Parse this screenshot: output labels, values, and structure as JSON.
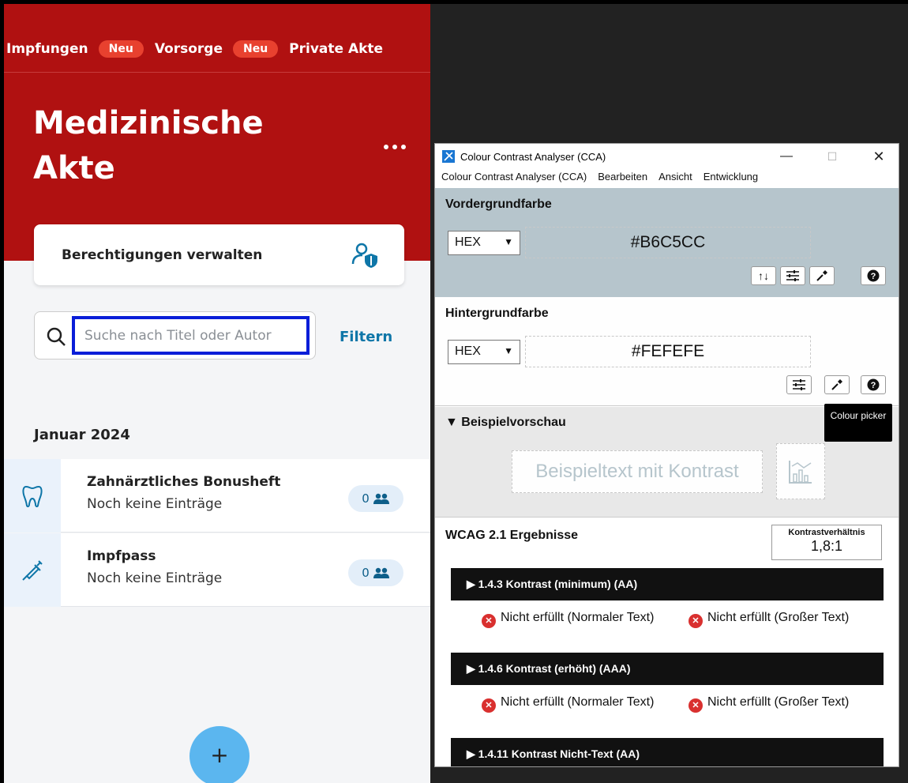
{
  "app": {
    "tabs": [
      {
        "label": "Impfungen",
        "badge": "Neu"
      },
      {
        "label": "Vorsorge",
        "badge": "Neu"
      },
      {
        "label": "Private Akte"
      }
    ],
    "page_title": "Medizinische Akte",
    "more_icon": "ellipsis-icon",
    "permissions": {
      "label": "Berechtigungen verwalten",
      "icon": "user-shield-icon"
    },
    "search": {
      "placeholder": "Suche nach Titel oder Autor",
      "value": ""
    },
    "filter_label": "Filtern",
    "month_heading": "Januar 2024",
    "records": [
      {
        "title": "Zahnärztliches Bonusheft",
        "subtitle": "Noch keine Einträge",
        "count": "0",
        "icon": "tooth-icon"
      },
      {
        "title": "Impfpass",
        "subtitle": "Noch keine Einträge",
        "count": "0",
        "icon": "syringe-icon"
      }
    ],
    "fab_label": "+",
    "colors": {
      "header": "#b01111",
      "badge": "#e8412f",
      "accent": "#0e76a8",
      "fab": "#5bb6ef",
      "focus": "#0a1ed8"
    }
  },
  "cca": {
    "window_title": "Colour Contrast Analyser (CCA)",
    "window_controls": {
      "minimize": "—",
      "maximize": "☐",
      "close": "✕"
    },
    "menu": [
      "Colour Contrast Analyser (CCA)",
      "Bearbeiten",
      "Ansicht",
      "Entwicklung"
    ],
    "foreground": {
      "heading": "Vordergrundfarbe",
      "format": "HEX",
      "value": "#B6C5CC",
      "color": "#b6c5cc"
    },
    "background": {
      "heading": "Hintergrundfarbe",
      "format": "HEX",
      "value": "#FEFEFE",
      "color": "#fefefe"
    },
    "preview": {
      "heading": "▼ Beispielvorschau",
      "sample_text": "Beispieltext mit Kontrast"
    },
    "tooltip": "Colour picker",
    "results": {
      "heading": "WCAG 2.1 Ergebnisse",
      "ratio_label": "Kontrastverhältnis",
      "ratio_value": "1,8:1",
      "criteria": [
        {
          "label": "▶ 1.4.3 Kontrast (minimum) (AA)",
          "normal": "Nicht erfüllt (Normaler Text)",
          "large": "Nicht erfüllt (Großer Text)"
        },
        {
          "label": "▶ 1.4.6 Kontrast (erhöht) (AAA)",
          "normal": "Nicht erfüllt (Normaler Text)",
          "large": "Nicht erfüllt (Großer Text)"
        },
        {
          "label": "▶ 1.4.11 Kontrast Nicht-Text (AA)"
        }
      ]
    }
  }
}
